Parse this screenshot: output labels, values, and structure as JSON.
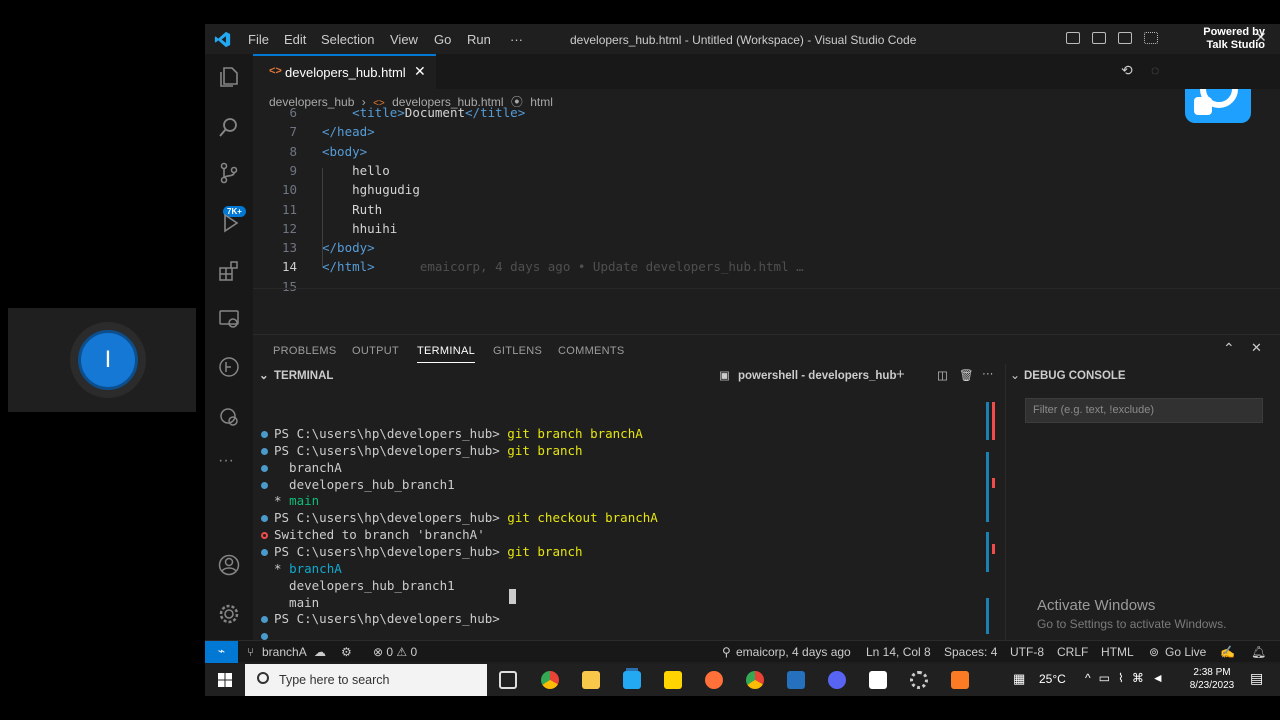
{
  "participant": {
    "initial": "I"
  },
  "window": {
    "title": "developers_hub.html - Untitled (Workspace) - Visual Studio Code",
    "menu": [
      "File",
      "Edit",
      "Selection",
      "View",
      "Go",
      "Run",
      "···"
    ]
  },
  "overlay": {
    "powered_line1": "Powered by",
    "powered_line2": "Talk Studio"
  },
  "activity": {
    "badge": "7K+"
  },
  "tab": {
    "label": "developers_hub.html",
    "close": "✕"
  },
  "breadcrumb": {
    "folder": "developers_hub",
    "sep": "›",
    "file": "developers_hub.html",
    "symbol": "html"
  },
  "editor": {
    "lines": [
      {
        "num": "6",
        "pre": "    ",
        "open": "<title>",
        "text": "Document",
        "close": "</title>"
      },
      {
        "num": "7",
        "pre": "",
        "open": "</head>",
        "text": "",
        "close": ""
      },
      {
        "num": "8",
        "pre": "",
        "open": "<body>",
        "text": "",
        "close": ""
      },
      {
        "num": "9",
        "pre": "    ",
        "open": "",
        "text": "hello",
        "close": ""
      },
      {
        "num": "10",
        "pre": "    ",
        "open": "",
        "text": "hghugudig",
        "close": ""
      },
      {
        "num": "11",
        "pre": "    ",
        "open": "",
        "text": "Ruth",
        "close": ""
      },
      {
        "num": "12",
        "pre": "    ",
        "open": "",
        "text": "hhuihi",
        "close": ""
      },
      {
        "num": "13",
        "pre": "",
        "open": "</body>",
        "text": "",
        "close": ""
      },
      {
        "num": "14",
        "pre": "",
        "open": "</html>",
        "text": "",
        "close": ""
      },
      {
        "num": "15",
        "pre": "",
        "open": "",
        "text": "",
        "close": ""
      }
    ],
    "blame": "emaicorp, 4 days ago • Update developers_hub.html …"
  },
  "panel": {
    "tabs": [
      "PROBLEMS",
      "OUTPUT",
      "TERMINAL",
      "GITLENS",
      "COMMENTS"
    ],
    "active_tab": "TERMINAL",
    "terminal_title": "TERMINAL",
    "shell": "powershell - developers_hub",
    "debug_title": "DEBUG CONSOLE",
    "filter_placeholder": "Filter (e.g. text, !exclude)"
  },
  "terminal": {
    "lines": [
      {
        "dot": "blue",
        "prompt": "PS C:\\users\\hp\\developers_hub> ",
        "cmd": "git branch branchA",
        "text": ""
      },
      {
        "dot": "blue",
        "prompt": "PS C:\\users\\hp\\developers_hub> ",
        "cmd": "git branch",
        "text": ""
      },
      {
        "dot": "blue",
        "prompt": "",
        "cmd": "",
        "text": "  branchA"
      },
      {
        "dot": "blue",
        "prompt": "",
        "cmd": "",
        "text": "  developers_hub_branch1"
      },
      {
        "dot": "",
        "prompt": "",
        "cmd": "",
        "text": "* ",
        "green": "main"
      },
      {
        "dot": "blue",
        "prompt": "PS C:\\users\\hp\\developers_hub> ",
        "cmd": "git checkout branchA",
        "text": ""
      },
      {
        "dot": "red",
        "prompt": "",
        "cmd": "",
        "text": "Switched to branch 'branchA'"
      },
      {
        "dot": "blue",
        "prompt": "PS C:\\users\\hp\\developers_hub> ",
        "cmd": "git branch",
        "text": ""
      },
      {
        "dot": "",
        "prompt": "",
        "cmd": "",
        "text": "* ",
        "green": "branchA"
      },
      {
        "dot": "",
        "prompt": "",
        "cmd": "",
        "text": "  developers_hub_branch1"
      },
      {
        "dot": "",
        "prompt": "",
        "cmd": "",
        "text": "  main"
      },
      {
        "dot": "blue",
        "prompt": "PS C:\\users\\hp\\developers_hub> ",
        "cmd": "",
        "text": ""
      }
    ]
  },
  "watermark": {
    "line1": "Activate Windows",
    "line2": "Go to Settings to activate Windows."
  },
  "statusbar": {
    "branch": "branchA",
    "errors": "⊗ 0 ⚠ 0",
    "blame": "emaicorp, 4 days ago",
    "position": "Ln 14, Col 8",
    "spaces": "Spaces: 4",
    "encoding": "UTF-8",
    "eol": "CRLF",
    "language": "HTML",
    "golive": "Go Live"
  },
  "taskbar": {
    "search_placeholder": "Type here to search",
    "temperature": "25°C",
    "time": "2:38 PM",
    "date": "8/23/2023"
  },
  "colors": {
    "accent": "#0078d4",
    "tag": "#569cd6",
    "command": "#e5e510",
    "branch": "#0dbc79"
  }
}
